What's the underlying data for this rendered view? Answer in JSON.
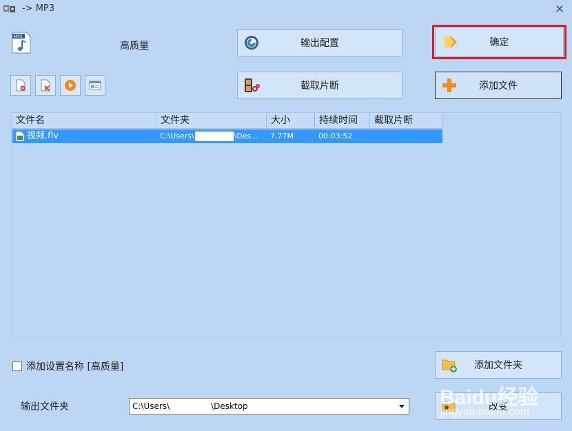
{
  "window": {
    "title": "-> MP3",
    "close_glyph": "×"
  },
  "profile": {
    "name": "高质量",
    "icon": "mp3-file-icon"
  },
  "buttons": {
    "output_config": "输出配置",
    "clip": "截取片断",
    "ok": "确定",
    "add_file": "添加文件",
    "add_folder": "添加文件夹",
    "change": "改变"
  },
  "toolbar_icons": [
    "remove-file-icon",
    "clear-list-icon",
    "play-icon",
    "info-icon"
  ],
  "file_list": {
    "columns": [
      "文件名",
      "文件夹",
      "大小",
      "持续时间",
      "截取片断"
    ],
    "rows": [
      {
        "name": "视频.flv",
        "folder_prefix": "C:\\Users\\",
        "folder_suffix": "\\Des...",
        "size": "7.77M",
        "duration": "00:03:52",
        "clip": ""
      }
    ]
  },
  "options": {
    "add_setting_name": "添加设置名称 [高质量]"
  },
  "output": {
    "label": "输出文件夹",
    "path_prefix": "C:\\Users\\",
    "path_suffix": "\\Desktop"
  },
  "watermark": {
    "main": "Baidu经验",
    "sub": "jingyan.baidu.com"
  },
  "colors": {
    "accent_red": "#d71f27",
    "selection": "#3399ff",
    "background": "#bcd7f3"
  }
}
